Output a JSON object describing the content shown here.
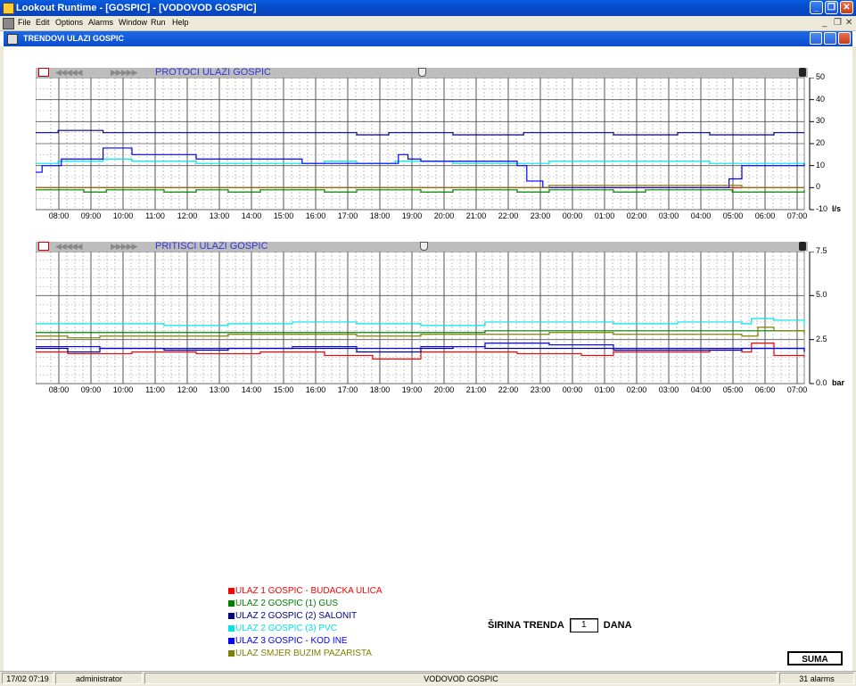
{
  "window": {
    "title": "Lookout Runtime - [GOSPIC] - [VODOVOD GOSPIC]"
  },
  "menu": [
    "File",
    "Edit",
    "Options",
    "Alarms",
    "Window",
    "Run",
    "Help"
  ],
  "child_window": {
    "title": "TRENDOVI ULAZI GOSPIC"
  },
  "colors": {
    "ulaz1": "#ff0000",
    "ulaz2_gus": "#008000",
    "ulaz2_salonit": "#000080",
    "ulaz2_pvc": "#00e5e5",
    "ulaz3": "#0000ff",
    "smjer": "#808000"
  },
  "chart_data": [
    {
      "type": "line",
      "title": "PROTOCI ULAZI GOSPIC",
      "unit": "l/s",
      "ylim": [
        -10,
        50
      ],
      "y_ticks": [
        "50",
        "40",
        "30",
        "20",
        "10",
        "0",
        "-10"
      ],
      "categories": [
        "08:00",
        "09:00",
        "10:00",
        "11:00",
        "12:00",
        "13:00",
        "14:00",
        "15:00",
        "16:00",
        "17:00",
        "18:00",
        "19:00",
        "20:00",
        "21:00",
        "22:00",
        "23:00",
        "00:00",
        "01:00",
        "02:00",
        "03:00",
        "04:00",
        "05:00",
        "06:00",
        "07:00"
      ],
      "grid": true,
      "series": [
        {
          "name": "ULAZ 1 GOSPIC - BUDACKA ULICA",
          "color_key": "ulaz1",
          "x": [
            0,
            24
          ],
          "y": [
            0,
            0
          ]
        },
        {
          "name": "ULAZ 2 GOSPIC (1) GUS",
          "color_key": "ulaz2_gus",
          "x": [
            0,
            1,
            1.5,
            2.2,
            3,
            4,
            5,
            6,
            7,
            8,
            9,
            10,
            11,
            12,
            13,
            14,
            15,
            16,
            17,
            18,
            19,
            20,
            21,
            21.7,
            24
          ],
          "y": [
            -1,
            -1,
            -2,
            -1,
            -1,
            -2,
            -1,
            -2,
            -1,
            -1,
            -2,
            -1,
            -1,
            -2,
            -1,
            -1,
            -2,
            -1,
            -1,
            -2,
            -1,
            -1,
            -1,
            -2,
            -1
          ]
        },
        {
          "name": "ULAZ 2 GOSPIC (2) SALONIT",
          "color_key": "ulaz2_salonit",
          "x": [
            0,
            0.7,
            2,
            2.1,
            5,
            8,
            8.5,
            10,
            11,
            11.2,
            12,
            13,
            15,
            15.2,
            16,
            17,
            17.7,
            18,
            19,
            20,
            20.5,
            21,
            21.7,
            22,
            23,
            24
          ],
          "y": [
            25,
            26,
            26,
            25,
            25,
            25,
            25,
            24,
            25,
            25,
            25,
            24,
            24,
            25,
            25,
            25,
            25,
            24,
            24,
            25,
            25,
            24,
            24,
            24,
            25,
            25
          ]
        },
        {
          "name": "ULAZ 2 GOSPIC (3) PVC",
          "color_key": "ulaz2_pvc",
          "x": [
            0,
            0.7,
            2,
            2.1,
            3,
            5,
            8,
            9,
            10,
            11,
            11.2,
            13,
            15,
            16,
            17,
            18,
            20,
            21,
            21.7,
            22,
            23,
            24
          ],
          "y": [
            11,
            12,
            12,
            13,
            12,
            11,
            11,
            12,
            11,
            11,
            12,
            11,
            11,
            12,
            12,
            12,
            12,
            11,
            11,
            11,
            11,
            12
          ]
        },
        {
          "name": "ULAZ 3 GOSPIC - KOD INE",
          "color_key": "ulaz3",
          "x": [
            0,
            0.2,
            0.8,
            1.2,
            2.0,
            2.1,
            3.0,
            5.0,
            8.0,
            8.3,
            10.0,
            11.1,
            11.3,
            11.6,
            12.0,
            14.0,
            15.0,
            15.3,
            15.8,
            16.0,
            21.0,
            21.6,
            22.0,
            23.0,
            24.0
          ],
          "y": [
            7,
            10,
            13,
            13,
            13,
            18,
            15,
            13,
            13,
            11,
            11,
            11,
            15,
            13,
            12,
            12,
            10,
            3,
            0,
            0,
            0,
            4,
            10,
            10,
            11
          ]
        },
        {
          "name": "ULAZ SMJER BUZIM PAZARISTA",
          "color_key": "smjer",
          "x": [
            0,
            15.5,
            16.0,
            21.5,
            22.0,
            24.0
          ],
          "y": [
            0,
            0,
            1,
            1,
            0,
            0
          ]
        }
      ]
    },
    {
      "type": "line",
      "title": "PRITISCI ULAZI GOSPIC",
      "unit": "bar",
      "ylim": [
        0,
        7.5
      ],
      "y_ticks": [
        "7.5",
        "5.0",
        "2.5",
        "0.0"
      ],
      "categories": [
        "08:00",
        "09:00",
        "10:00",
        "11:00",
        "12:00",
        "13:00",
        "14:00",
        "15:00",
        "16:00",
        "17:00",
        "18:00",
        "19:00",
        "20:00",
        "21:00",
        "22:00",
        "23:00",
        "00:00",
        "01:00",
        "02:00",
        "03:00",
        "04:00",
        "05:00",
        "06:00",
        "07:00"
      ],
      "grid": true,
      "series": [
        {
          "name": "ULAZ 1 GOSPIC - BUDACKA ULICA",
          "color_key": "ulaz1",
          "x": [
            0,
            1,
            3,
            5,
            7,
            8,
            9,
            10,
            10.5,
            11,
            12,
            13,
            14,
            15,
            16,
            17,
            18,
            19,
            20,
            21,
            22,
            22.3,
            22.5,
            23,
            24
          ],
          "y": [
            1.8,
            1.7,
            1.8,
            1.7,
            1.8,
            1.8,
            1.6,
            1.6,
            1.4,
            1.4,
            1.8,
            1.8,
            1.8,
            1.7,
            1.7,
            1.6,
            1.8,
            1.8,
            1.8,
            1.9,
            1.8,
            2.3,
            2.3,
            1.6,
            1.5
          ]
        },
        {
          "name": "ULAZ 2 GOSPIC (1) GUS",
          "color_key": "ulaz2_gus",
          "x": [
            0,
            2,
            4,
            6,
            8,
            10,
            12,
            14,
            16,
            18,
            20,
            22,
            24
          ],
          "y": [
            2.9,
            2.9,
            2.9,
            2.9,
            2.9,
            2.9,
            2.9,
            3.0,
            3.0,
            3.0,
            3.0,
            3.0,
            2.9
          ]
        },
        {
          "name": "ULAZ 2 GOSPIC (2) SALONIT",
          "color_key": "ulaz2_salonit",
          "x": [
            0,
            1,
            2,
            4,
            5,
            6,
            8,
            10,
            12,
            13,
            14,
            15,
            16,
            18,
            20,
            22,
            23,
            24
          ],
          "y": [
            2.0,
            1.8,
            2.0,
            1.9,
            1.9,
            2.0,
            2.0,
            1.8,
            2.0,
            2.1,
            2.0,
            2.0,
            2.0,
            1.9,
            1.9,
            2.0,
            2.0,
            1.8
          ]
        },
        {
          "name": "ULAZ 2 GOSPIC (3) PVC",
          "color_key": "ulaz2_pvc",
          "x": [
            0,
            2,
            4,
            6,
            8,
            10,
            12,
            14,
            16,
            18,
            20,
            21,
            22,
            22.3,
            23,
            24
          ],
          "y": [
            3.4,
            3.4,
            3.3,
            3.4,
            3.5,
            3.4,
            3.3,
            3.5,
            3.5,
            3.4,
            3.5,
            3.5,
            3.4,
            3.7,
            3.6,
            3.3
          ]
        },
        {
          "name": "ULAZ 3 GOSPIC - KOD INE",
          "color_key": "ulaz3",
          "x": [
            0,
            2,
            4,
            6,
            8,
            10,
            12,
            14,
            16,
            18,
            20,
            22,
            24
          ],
          "y": [
            2.1,
            2.0,
            2.0,
            2.0,
            2.1,
            2.0,
            2.1,
            2.3,
            2.2,
            2.0,
            2.0,
            2.0,
            1.8
          ]
        },
        {
          "name": "ULAZ SMJER BUZIM PAZARISTA",
          "color_key": "smjer",
          "x": [
            0,
            1,
            2,
            4,
            6,
            8,
            10,
            12,
            14,
            16,
            18,
            20,
            22,
            22.5,
            23,
            24
          ],
          "y": [
            2.7,
            2.6,
            2.7,
            2.7,
            2.8,
            2.8,
            2.7,
            2.8,
            2.8,
            2.9,
            2.8,
            2.8,
            2.7,
            3.2,
            3.0,
            2.8
          ]
        }
      ]
    }
  ],
  "legend": [
    {
      "label": "ULAZ 1 GOSPIC - BUDACKA ULICA",
      "color_key": "ulaz1"
    },
    {
      "label": "ULAZ 2 GOSPIC (1) GUS",
      "color_key": "ulaz2_gus"
    },
    {
      "label": "ULAZ 2 GOSPIC (2) SALONIT",
      "color_key": "ulaz2_salonit"
    },
    {
      "label": "ULAZ 2 GOSPIC (3) PVC",
      "color_key": "ulaz2_pvc"
    },
    {
      "label": "ULAZ 3 GOSPIC - KOD INE",
      "color_key": "ulaz3"
    },
    {
      "label": "ULAZ SMJER BUZIM PAZARISTA",
      "color_key": "smjer"
    }
  ],
  "controls": {
    "sirina_label": "ŠIRINA TRENDA",
    "sirina_value": "1",
    "dana_label": "DANA",
    "suma_label": "SUMA"
  },
  "status": {
    "datetime": "17/02 07:19",
    "user": "administrator",
    "process": "VODOVOD GOSPIC",
    "alarms": "31 alarms"
  }
}
